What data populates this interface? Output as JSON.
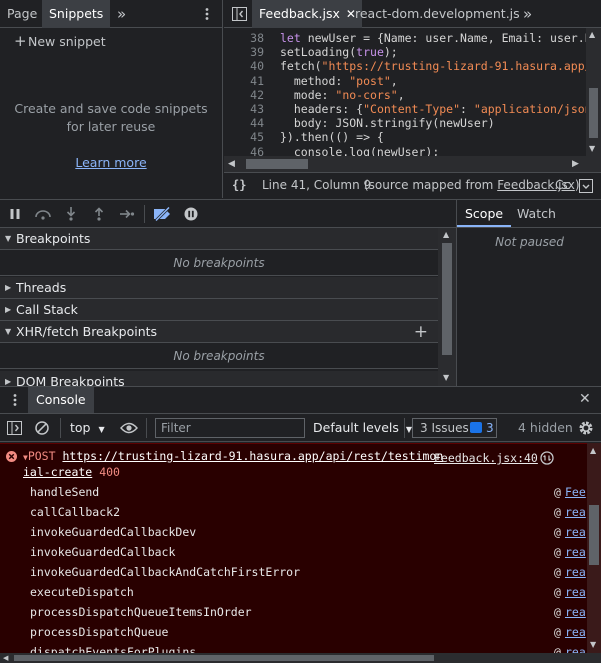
{
  "sources_sidebar": {
    "tabs": [
      {
        "label": "Page"
      },
      {
        "label": "Snippets",
        "active": true
      }
    ],
    "more_tabs": "»",
    "new_snippet_label": "New snippet",
    "empty_message_line1": "Create and save code snippets",
    "empty_message_line2": "for later reuse",
    "learn_more": "Learn more"
  },
  "editor": {
    "tabs": [
      {
        "label": "Feedback.jsx",
        "active": true
      },
      {
        "label": "react-dom.development.js",
        "active": false
      }
    ],
    "more_tabs": "»",
    "line_numbers": [
      "38",
      "39",
      "40",
      "41",
      "42",
      "43",
      "44",
      "45",
      "46"
    ],
    "lines": [
      [
        {
          "t": "let ",
          "c": "kw"
        },
        {
          "t": "newUser = {Name: user.Name, Email: user.Em",
          "c": "id"
        }
      ],
      [
        {
          "t": "setLoading(",
          "c": "id"
        },
        {
          "t": "true",
          "c": "kw"
        },
        {
          "t": ");",
          "c": "id"
        }
      ],
      [
        {
          "t": "fetch(",
          "c": "id"
        },
        {
          "t": "\"https://trusting-lizard-91.hasura.app/a",
          "c": "str"
        }
      ],
      [
        {
          "t": "  method: ",
          "c": "id"
        },
        {
          "t": "\"post\"",
          "c": "str"
        },
        {
          "t": ",",
          "c": "id"
        }
      ],
      [
        {
          "t": "  mode: ",
          "c": "id"
        },
        {
          "t": "\"no-cors\"",
          "c": "str"
        },
        {
          "t": ",",
          "c": "id"
        }
      ],
      [
        {
          "t": "  headers: {",
          "c": "id"
        },
        {
          "t": "\"Content-Type\"",
          "c": "str"
        },
        {
          "t": ": ",
          "c": "id"
        },
        {
          "t": "\"application/json\"",
          "c": "str"
        }
      ],
      [
        {
          "t": "  body: JSON.stringify(newUser)",
          "c": "id"
        }
      ],
      [
        {
          "t": "}).then(() => {",
          "c": "id"
        }
      ],
      [
        {
          "t": "  console.log(newUser);",
          "c": "id"
        }
      ]
    ],
    "status": {
      "braces": "{}",
      "position": "Line 41, Column 9",
      "source_mapped_prefix": "(source mapped from ",
      "source_mapped_link": "Feedback.jsx",
      "source_mapped_suffix": ")",
      "coverage": "Cc"
    }
  },
  "debugger": {
    "scope_tabs": [
      {
        "label": "Scope",
        "active": true
      },
      {
        "label": "Watch",
        "active": false
      }
    ],
    "not_paused": "Not paused",
    "sections": [
      {
        "label": "Breakpoints",
        "expanded": true,
        "empty": "No breakpoints"
      },
      {
        "label": "Threads",
        "expanded": false
      },
      {
        "label": "Call Stack",
        "expanded": false
      },
      {
        "label": "XHR/fetch Breakpoints",
        "expanded": true,
        "empty": "No breakpoints",
        "has_add": true
      },
      {
        "label": "DOM Breakpoints",
        "expanded": false
      }
    ]
  },
  "drawer": {
    "tab_label": "Console",
    "context": "top",
    "filter_placeholder": "Filter",
    "levels": "Default levels",
    "issues_label": "3 Issues:",
    "issues_count": "3",
    "hidden": "4 hidden"
  },
  "console": {
    "error": {
      "method": "POST",
      "url_line1": "https://trusting-lizard-91.hasura.app/api/rest/testimon",
      "url_line2": "ial-create",
      "status": "400",
      "source": "Feedback.jsx:40"
    },
    "stack": [
      {
        "fn": "handleSend",
        "src": "Fee"
      },
      {
        "fn": "callCallback2",
        "src": "rea"
      },
      {
        "fn": "invokeGuardedCallbackDev",
        "src": "rea"
      },
      {
        "fn": "invokeGuardedCallback",
        "src": "rea"
      },
      {
        "fn": "invokeGuardedCallbackAndCatchFirstError",
        "src": "rea"
      },
      {
        "fn": "executeDispatch",
        "src": "rea"
      },
      {
        "fn": "processDispatchQueueItemsInOrder",
        "src": "rea"
      },
      {
        "fn": "processDispatchQueue",
        "src": "rea"
      },
      {
        "fn": "dispatchEventsForPlugins",
        "src": "rea"
      }
    ],
    "at_symbol": "@"
  },
  "colors": {
    "error_bg": "#290000",
    "link": "#8ab4f8",
    "panel_bg": "#202124",
    "accent_blue": "#1a73e8"
  }
}
